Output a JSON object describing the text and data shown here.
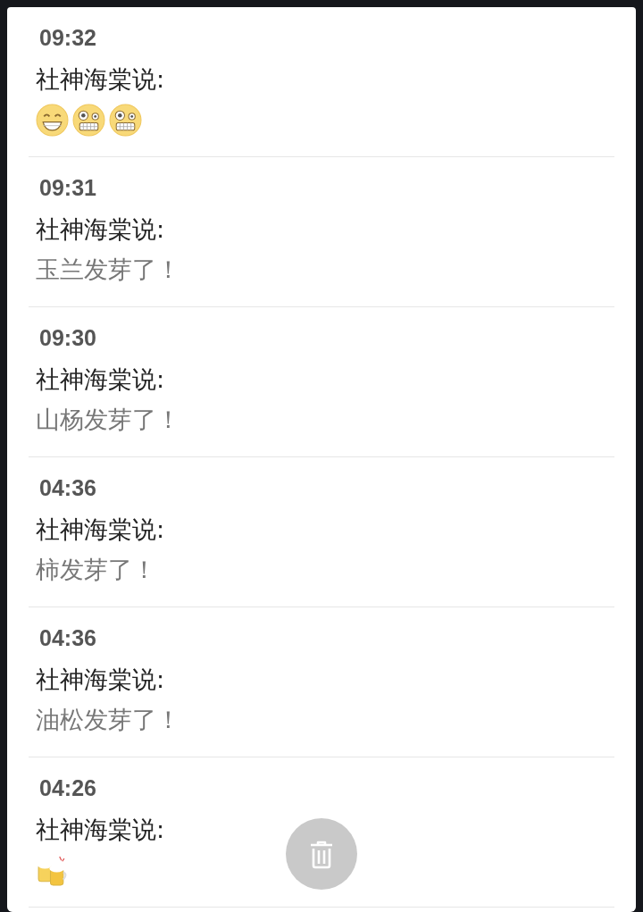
{
  "messages": [
    {
      "time": "09:32",
      "sender": "社神海棠说:",
      "kind": "emoji",
      "emojis": [
        {
          "kind": "grin"
        },
        {
          "kind": "grimace"
        },
        {
          "kind": "grimace"
        }
      ]
    },
    {
      "time": "09:31",
      "sender": "社神海棠说:",
      "kind": "text",
      "text": "玉兰发芽了！"
    },
    {
      "time": "09:30",
      "sender": "社神海棠说:",
      "kind": "text",
      "text": "山杨发芽了！"
    },
    {
      "time": "04:36",
      "sender": "社神海棠说:",
      "kind": "text",
      "text": "柿发芽了！"
    },
    {
      "time": "04:36",
      "sender": "社神海棠说:",
      "kind": "text",
      "text": "油松发芽了！"
    },
    {
      "time": "04:26",
      "sender": "社神海棠说:",
      "kind": "emoji",
      "emojis": [
        {
          "kind": "beer"
        }
      ]
    }
  ]
}
